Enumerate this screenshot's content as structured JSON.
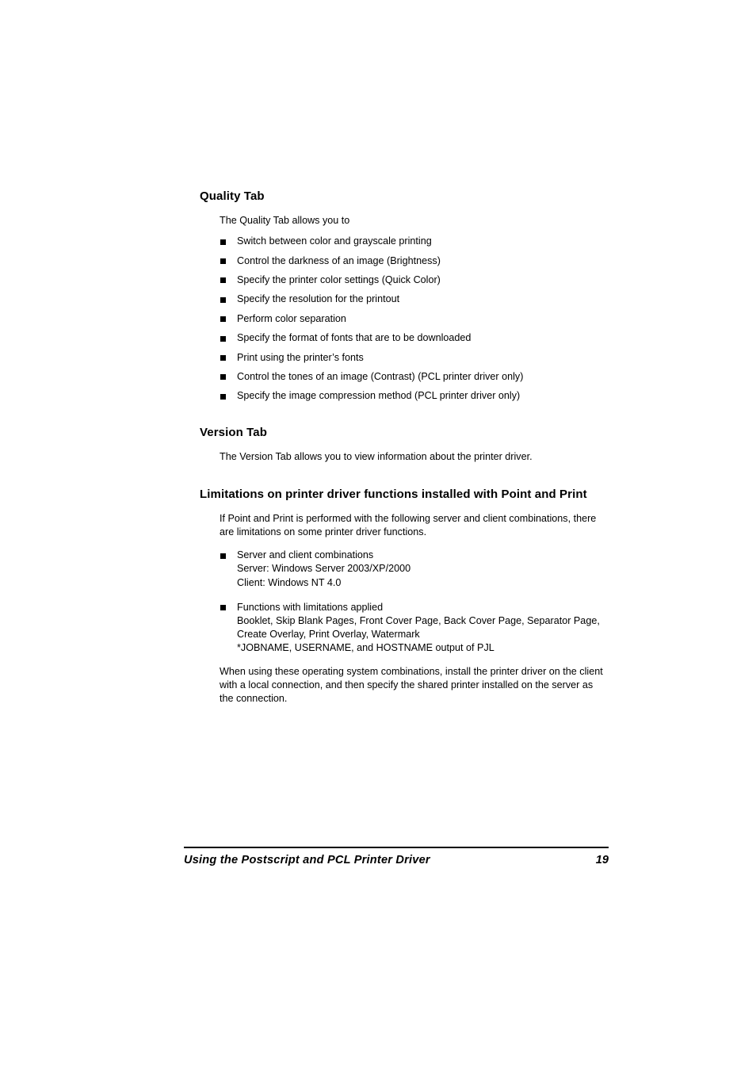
{
  "document": {
    "page_number": "19",
    "footer_title": "Using the Postscript and PCL Printer Driver"
  },
  "sections": {
    "quality": {
      "heading": "Quality Tab",
      "intro": "The Quality Tab allows you to",
      "bullets": [
        "Switch between color and grayscale printing",
        "Control the darkness of an image (Brightness)",
        "Specify the printer color settings (Quick Color)",
        "Specify the resolution for the printout",
        "Perform color separation",
        "Specify the format of fonts that are to be downloaded",
        "Print using the printer’s fonts",
        "Control the tones of an image (Contrast) (PCL printer driver only)",
        "Specify the image compression method (PCL printer driver only)"
      ]
    },
    "version": {
      "heading": "Version Tab",
      "intro": "The Version Tab allows you to view information about the printer driver."
    },
    "limitations": {
      "heading": "Limitations on printer driver functions installed with Point and Print",
      "intro": "If Point and Print is performed with the following server and client combinations, there are limitations on some printer driver functions.",
      "bullet_1_title": "Server and client combinations",
      "bullet_1_line_1": "Server: Windows Server 2003/XP/2000",
      "bullet_1_line_2": "Client: Windows NT 4.0",
      "bullet_2_title": "Functions with limitations applied",
      "bullet_2_line_1": "Booklet, Skip Blank Pages, Front Cover Page, Back Cover Page, Separator Page, Create Overlay, Print Overlay, Watermark",
      "bullet_2_line_2": "*JOBNAME, USERNAME, and HOSTNAME output of PJL",
      "closing": "When using these operating system combinations, install the printer driver on the client with a local connection, and then specify the shared printer installed on the server as the connection."
    }
  }
}
